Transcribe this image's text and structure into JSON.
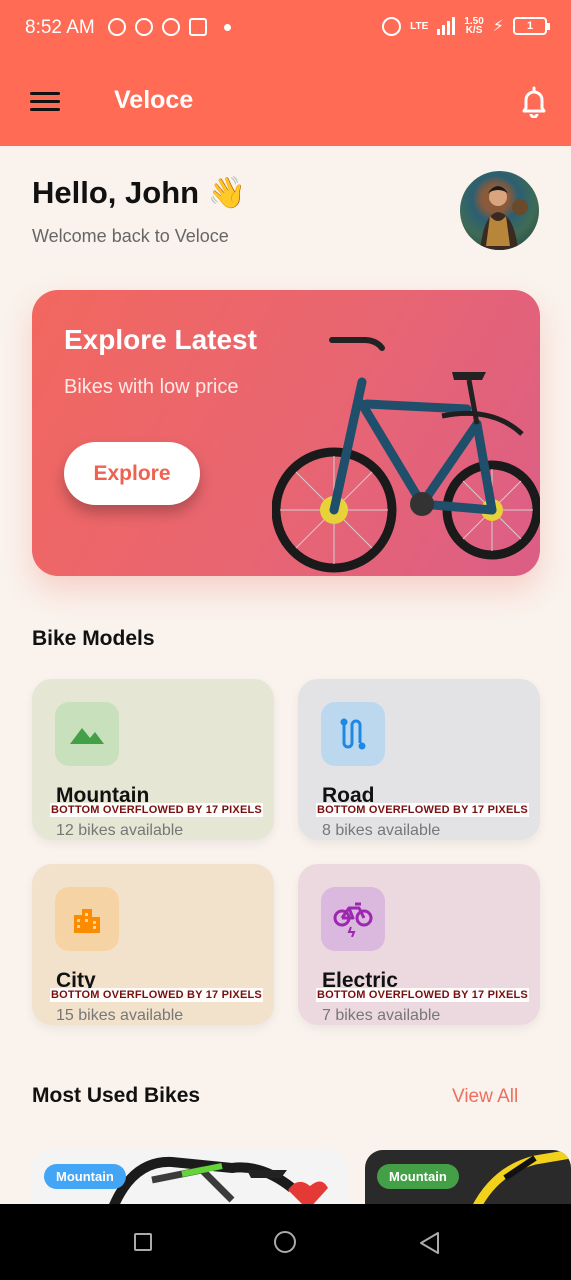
{
  "status_bar": {
    "time": "8:52 AM",
    "network": "LTE",
    "speed": "1.50",
    "speed_unit": "K/S",
    "battery": "1"
  },
  "app_bar": {
    "title": "Veloce"
  },
  "greeting": {
    "title": "Hello, John 👋",
    "subtitle": "Welcome back to Veloce"
  },
  "banner": {
    "title": "Explore Latest",
    "subtitle": "Bikes with low price",
    "button_label": "Explore"
  },
  "bike_models": {
    "title": "Bike Models",
    "overflow_message": "BOTTOM OVERFLOWED BY 17 PIXELS",
    "items": [
      {
        "name": "Mountain",
        "count": "12 bikes available",
        "icon": "mountain-icon",
        "color": "#4caf50"
      },
      {
        "name": "Road",
        "count": "8 bikes available",
        "icon": "route-icon",
        "color": "#2196f3"
      },
      {
        "name": "City",
        "count": "15 bikes available",
        "icon": "city-icon",
        "color": "#ff9800"
      },
      {
        "name": "Electric",
        "count": "7 bikes available",
        "icon": "electric-bike-icon",
        "color": "#9c27b0"
      }
    ]
  },
  "most_used": {
    "title": "Most Used Bikes",
    "view_all": "View All",
    "items": [
      {
        "tag": "Mountain",
        "tag_color": "#42a5f5"
      },
      {
        "tag": "Mountain",
        "tag_color": "#43a047"
      }
    ]
  },
  "colors": {
    "accent": "#ff6b55",
    "background": "#faf2ec"
  }
}
